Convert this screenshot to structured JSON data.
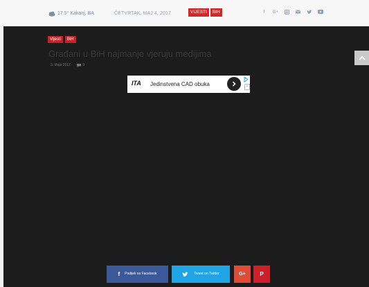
{
  "topbar": {
    "weather": {
      "icon": "weather-icon",
      "text": "17.5° Kakanj, BA"
    },
    "date": "ČETVRTAK, MAJ 4, 2017",
    "tags": [
      "VIJESTI",
      "BiH"
    ],
    "socials": [
      {
        "name": "facebook-icon",
        "glyph": "f"
      },
      {
        "name": "google-plus-icon",
        "glyph": "G+"
      },
      {
        "name": "instagram-icon",
        "glyph": ""
      },
      {
        "name": "email-icon",
        "glyph": ""
      },
      {
        "name": "twitter-icon",
        "glyph": ""
      },
      {
        "name": "youtube-icon",
        "glyph": ""
      }
    ]
  },
  "article": {
    "tags": [
      "Vijesti",
      "BiH"
    ],
    "title": "Građani u BiH najmanje vjeruju medijima",
    "date": "3. Maja 2017.",
    "comments": "0"
  },
  "ad": {
    "logo": "ITA",
    "text": "Jedinstvena CAD obuka"
  },
  "share": {
    "facebook": "Podijeli na Facebook",
    "twitter": "Tweet on Twitter",
    "googleplus": "G+",
    "pinterest": "P"
  },
  "colors": {
    "accent_red": "#d4262c",
    "facebook": "#3b5998",
    "twitter": "#1fa4e4",
    "googleplus": "#dd4b39",
    "overlay": "#1c1c1c"
  }
}
